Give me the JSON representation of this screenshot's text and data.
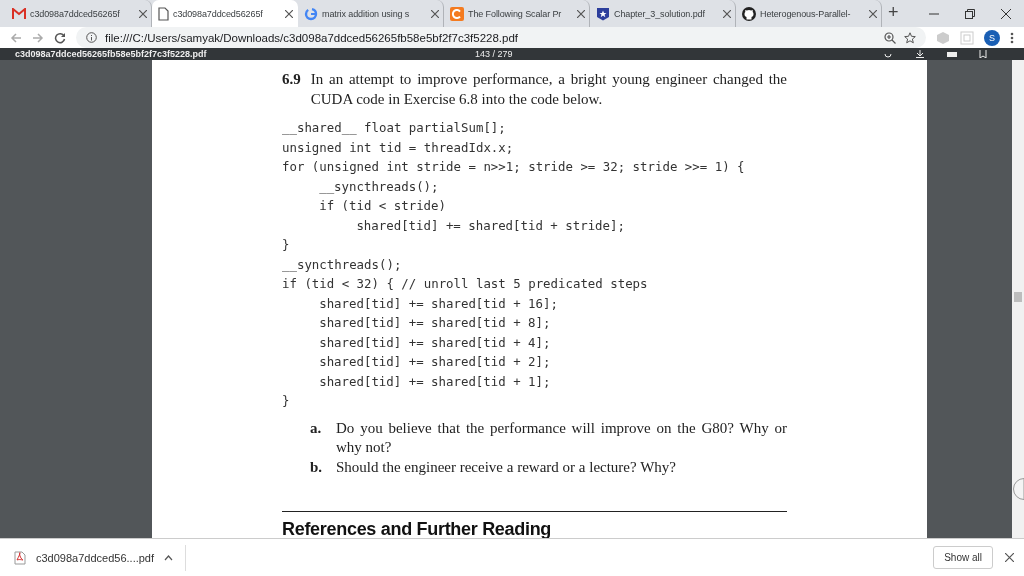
{
  "tabs": [
    {
      "title": "c3d098a7ddced56265f",
      "kind": "mail",
      "selected": false
    },
    {
      "title": "c3d098a7ddced56265f",
      "kind": "document",
      "selected": true
    },
    {
      "title": "matrix addition using s",
      "kind": "search",
      "selected": false
    },
    {
      "title": "The Following Scalar Pr",
      "kind": "site",
      "selected": false
    },
    {
      "title": "Chapter_3_solution.pdf",
      "kind": "shield",
      "selected": false
    },
    {
      "title": "Heterogenous-Parallel-",
      "kind": "repo",
      "selected": false
    }
  ],
  "new_tab": "+",
  "address_bar": {
    "url": "file:///C:/Users/samyak/Downloads/c3d098a7ddced56265fb58e5bf2f7c3f5228.pdf",
    "profile": "S"
  },
  "pdf_toolbar": {
    "file_name": "c3d098a7ddced56265fb58e5bf2f7c3f5228.pdf",
    "page": "143 / 279"
  },
  "document": {
    "exercise_number": "6.9",
    "exercise_text": "In an attempt to improve performance, a bright young engineer changed the CUDA code in Exercise 6.8 into the code below.",
    "code": [
      {
        "text": "__shared__ float partialSum[];"
      },
      {
        "text": "unsigned int tid = threadIdx.x;"
      },
      {
        "text": "for (unsigned int stride = n>>1; stride >= 32; stride >>= 1) {",
        "children": [
          {
            "text": "__syncthreads();"
          },
          {
            "text": "if (tid < stride)",
            "children": [
              {
                "text": "shared[tid] += shared[tid + stride];"
              }
            ]
          }
        ]
      },
      {
        "text": "}"
      },
      {
        "text": "__syncthreads();"
      },
      {
        "text": "if (tid < 32) { // unroll last 5 predicated steps",
        "children": [
          {
            "text": "shared[tid] += shared[tid + 16];"
          },
          {
            "text": "shared[tid] += shared[tid + 8];"
          },
          {
            "text": "shared[tid] += shared[tid + 4];"
          },
          {
            "text": "shared[tid] += shared[tid + 2];"
          },
          {
            "text": "shared[tid] += shared[tid + 1];"
          }
        ]
      },
      {
        "text": "}"
      }
    ],
    "questions": [
      {
        "label": "a.",
        "text": "Do you believe that the performance will improve on the G80? Why or why not?"
      },
      {
        "label": "b.",
        "text": "Should the engineer receive a reward or a lecture? Why?"
      }
    ],
    "heading": "References and Further Reading"
  },
  "download_bar": {
    "file": "c3d098a7ddced56....pdf",
    "show_all": "Show all"
  }
}
